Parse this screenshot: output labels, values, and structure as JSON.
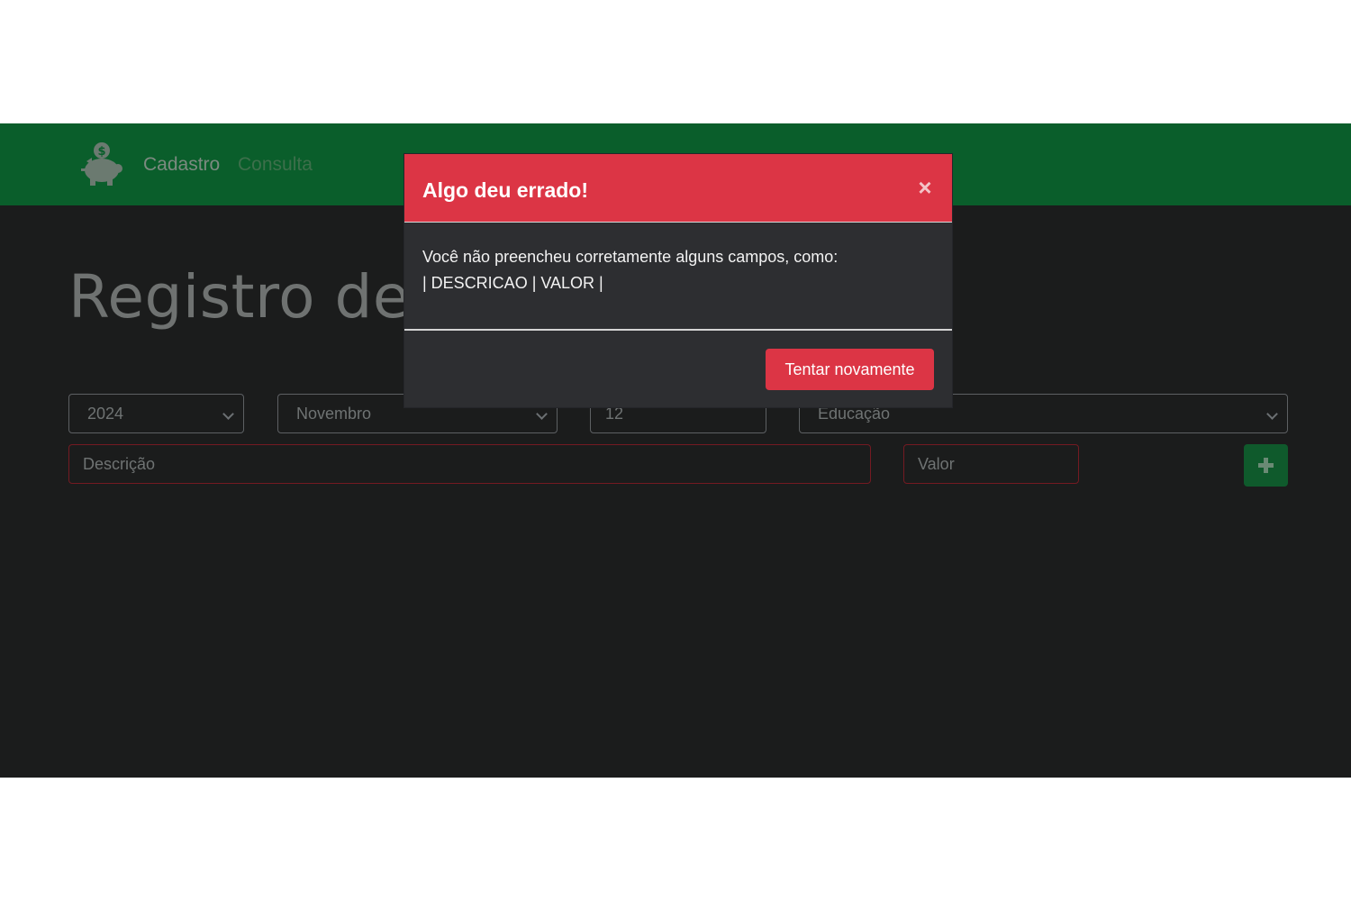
{
  "nav": {
    "logo_icon": "piggy-bank-icon",
    "items": [
      {
        "label": "Cadastro"
      },
      {
        "label": "Consulta"
      }
    ]
  },
  "page": {
    "title": "Registro de n"
  },
  "form": {
    "year": {
      "value": "2024"
    },
    "month": {
      "value": "Novembro"
    },
    "day": {
      "value": "12"
    },
    "category": {
      "value": "Educação"
    },
    "description": {
      "placeholder": "Descrição"
    },
    "valor": {
      "placeholder": "Valor"
    },
    "add_icon": "plus-icon"
  },
  "modal": {
    "title": "Algo deu errado!",
    "close_symbol": "×",
    "message_line1": "Você não preencheu corretamente alguns campos, como:",
    "message_line2": "| DESCRICAO | VALOR |",
    "retry_label": "Tentar novamente"
  },
  "colors": {
    "navbar": "#0a5e2b",
    "background": "#1b1c1c",
    "danger": "#dc3545",
    "modal_body": "#2d2e31",
    "invalid_border": "#741a22"
  }
}
